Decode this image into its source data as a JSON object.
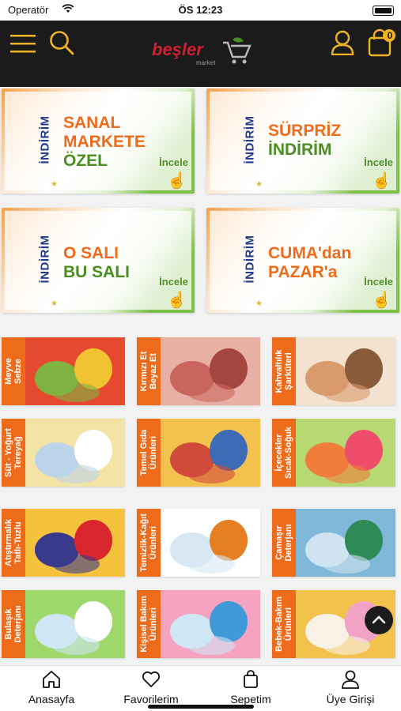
{
  "status": {
    "carrier": "Operatör",
    "time": "ÖS 12:23"
  },
  "header": {
    "menu_icon": "hamburger-icon",
    "search_icon": "search-icon",
    "logo_text": "beşler",
    "logo_sub": "market",
    "user_icon": "user-icon",
    "cart_icon": "shopping-bag-icon",
    "cart_count": "0",
    "accent": "#f0b323"
  },
  "banners": [
    {
      "tag": "İNDİRİM",
      "line1": "SANAL",
      "line2": "MARKETE",
      "line3": "ÖZEL",
      "cta": "İncele"
    },
    {
      "tag": "İNDİRİM",
      "line1": "SÜRPRİZ",
      "line2": "İNDİRİM",
      "line3": "",
      "cta": "İncele"
    },
    {
      "tag": "İNDİRİM",
      "line1": "O SALI",
      "line2": "BU SALI",
      "line3": "",
      "cta": "İncele"
    },
    {
      "tag": "İNDİRİM",
      "line1": "CUMA'dan",
      "line2": "PAZAR'a",
      "line3": "",
      "cta": "İncele"
    }
  ],
  "categories": [
    {
      "label1": "Meyve",
      "label2": "Sebze"
    },
    {
      "label1": "Kırmızı Et",
      "label2": "Beyaz Et"
    },
    {
      "label1": "Kahvaltılık",
      "label2": "Şarküteri"
    },
    {
      "label1": "Süt - Yoğurt",
      "label2": "Tereyağ"
    },
    {
      "label1": "Temel Gıda",
      "label2": "Ürünleri"
    },
    {
      "label1": "İçecekler",
      "label2": "Sıcak-Soğuk"
    },
    {
      "label1": "Atıştırmalık",
      "label2": "Tatlı-Tuzlu"
    },
    {
      "label1": "Temizlik-Kağıt",
      "label2": "Ürünleri"
    },
    {
      "label1": "Çamaşır",
      "label2": "Deterjanı"
    },
    {
      "label1": "Bulaşık",
      "label2": "Deterjanı"
    },
    {
      "label1": "Kişisel Bakım",
      "label2": "Ürünleri"
    },
    {
      "label1": "Bebek-Bakım",
      "label2": "Ürünleri"
    }
  ],
  "tabs": [
    {
      "label": "Anasayfa",
      "icon": "home-icon"
    },
    {
      "label": "Favorilerim",
      "icon": "heart-icon"
    },
    {
      "label": "Sepetim",
      "icon": "bag-icon"
    },
    {
      "label": "Üye Girişi",
      "icon": "user-icon"
    }
  ],
  "scroll_top_icon": "chevron-up-icon",
  "colors": {
    "orange": "#ee6b1c",
    "green": "#4a8e1f",
    "navy": "#1e3a8a",
    "dark": "#1b1b1b",
    "logo_red": "#d1202f"
  }
}
